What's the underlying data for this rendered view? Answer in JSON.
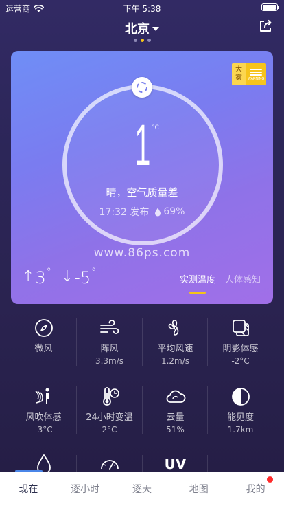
{
  "status_bar": {
    "carrier": "运营商",
    "time": "下午 5:38",
    "battery_level": 0.95
  },
  "header": {
    "city": "北京",
    "page_count": 3,
    "active_page": 1
  },
  "card": {
    "badge": {
      "line1": "大",
      "line2": "雾",
      "text": "WARNING"
    },
    "temperature": "1",
    "unit": "°C",
    "description": "晴，空气质量差",
    "publish_time": "17:32 发布",
    "humidity": "69%",
    "watermark": "www.86ps.com",
    "high": "3",
    "low": "-5",
    "high_arrow": "↑",
    "low_arrow": "↓",
    "degree": "°",
    "tabs": [
      "实测温度",
      "人体感知"
    ],
    "active_tab": 0
  },
  "details": [
    {
      "icon": "compass-icon",
      "label": "微风",
      "value": ""
    },
    {
      "icon": "wind-icon",
      "label": "阵风",
      "value": "3.3m/s"
    },
    {
      "icon": "fan-icon",
      "label": "平均风速",
      "value": "1.2m/s"
    },
    {
      "icon": "shade-icon",
      "label": "阴影体感",
      "value": "-2°C"
    },
    {
      "icon": "wind-person-icon",
      "label": "风吹体感",
      "value": "-3°C"
    },
    {
      "icon": "thermometer-clock-icon",
      "label": "24小时变温",
      "value": "2°C"
    },
    {
      "icon": "cloud-icon",
      "label": "云量",
      "value": "51%"
    },
    {
      "icon": "visibility-icon",
      "label": "能见度",
      "value": "1.7km"
    },
    {
      "icon": "drop-icon",
      "label": "",
      "value": ""
    },
    {
      "icon": "gauge-icon",
      "label": "",
      "value": ""
    },
    {
      "icon": "uv-icon",
      "label": "UV",
      "value": ""
    }
  ],
  "nav": {
    "items": [
      "现在",
      "逐小时",
      "逐天",
      "地图",
      "我的"
    ],
    "active": 0,
    "accent": "#4a86e8",
    "notification_color": "#ff2b2b"
  },
  "colors": {
    "accent_yellow": "#f5c518"
  }
}
